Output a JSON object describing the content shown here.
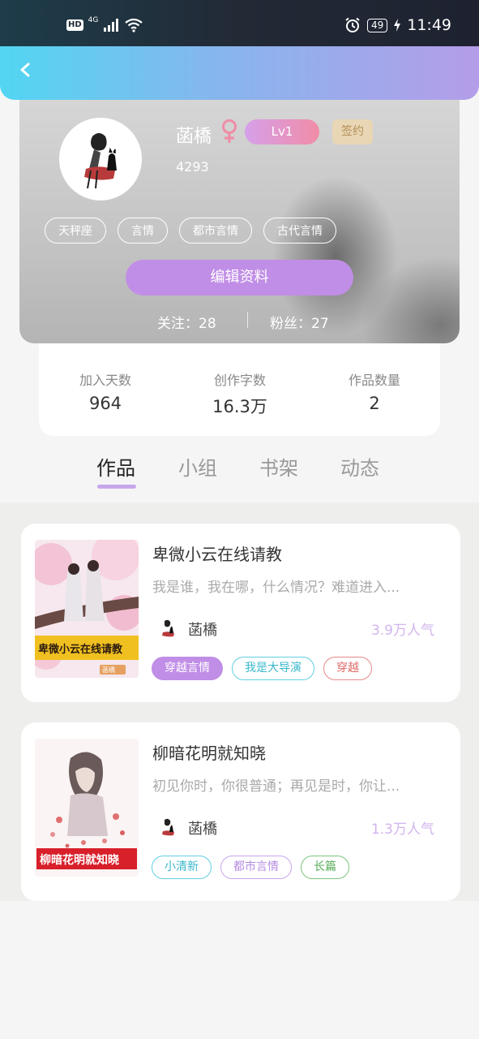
{
  "status_bar": {
    "hd": "HD",
    "signal": "4G",
    "battery": "49",
    "time": "11:49"
  },
  "profile": {
    "name": "菡橋",
    "level": "Lv1",
    "sign_badge": "签约",
    "uid": "4293",
    "tags": [
      "天秤座",
      "言情",
      "都市言情",
      "古代言情"
    ],
    "edit_button": "编辑资料",
    "following": "关注：28",
    "followers": "粉丝：27"
  },
  "stats": [
    {
      "label": "加入天数",
      "value": "964"
    },
    {
      "label": "创作字数",
      "value": "16.3万"
    },
    {
      "label": "作品数量",
      "value": "2"
    }
  ],
  "tabs": [
    "作品",
    "小组",
    "书架",
    "动态"
  ],
  "works": [
    {
      "title": "卑微小云在线请教",
      "desc": "我是谁，我在哪，什么情况？难道进入...",
      "author": "菡橋",
      "popularity": "3.9万人气",
      "cover_text": "卑微小云在线请教",
      "cover_badge": "菡橋",
      "tags": [
        {
          "label": "穿越言情",
          "style": "filled-purple"
        },
        {
          "label": "我是大导演",
          "style": "outline-cyan"
        },
        {
          "label": "穿越",
          "style": "outline-red"
        }
      ]
    },
    {
      "title": "柳暗花明就知晓",
      "desc": "初见你时，你很普通；再见是时，你让...",
      "author": "菡橋",
      "popularity": "1.3万人气",
      "cover_text": "柳暗花明就知晓",
      "tags": [
        {
          "label": "小清新",
          "style": "outline-cyan"
        },
        {
          "label": "都市言情",
          "style": "outline-purple"
        },
        {
          "label": "长篇",
          "style": "outline-green"
        }
      ]
    }
  ],
  "colors": {
    "accent": "#c08ee6",
    "header_start": "#52d6f2",
    "header_end": "#b49de8",
    "popularity": "#d2b4ee"
  }
}
